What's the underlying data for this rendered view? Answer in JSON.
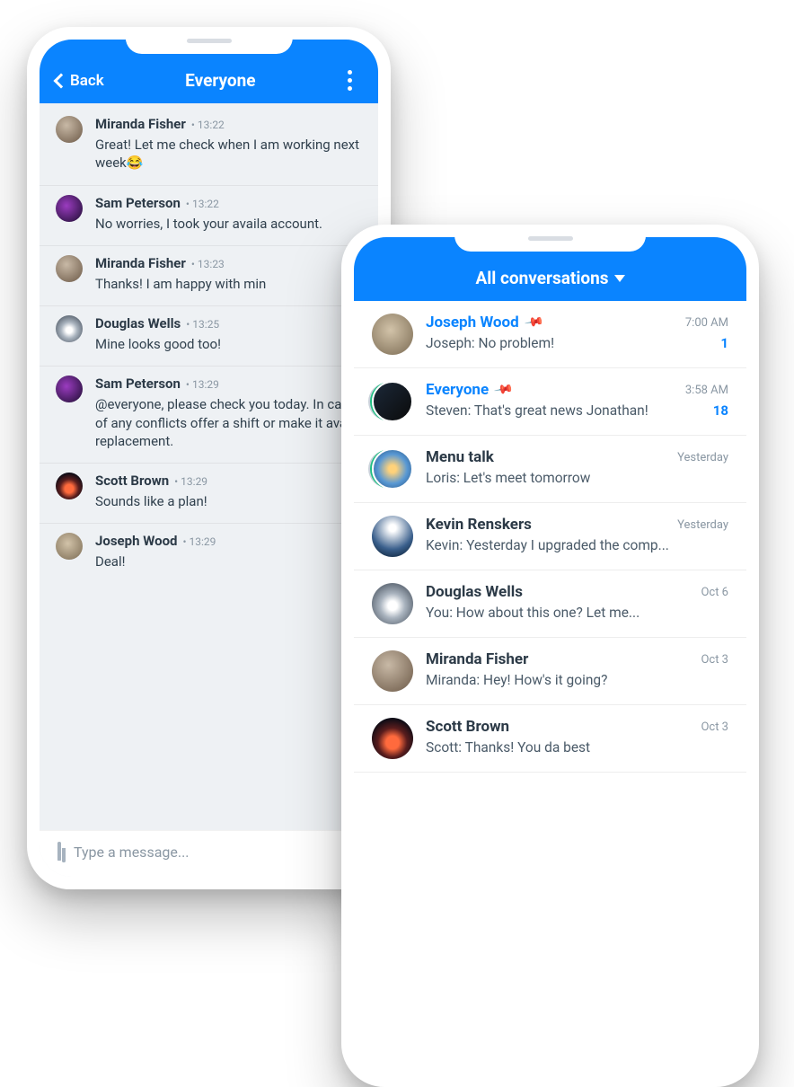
{
  "chat": {
    "back_label": "Back",
    "title": "Everyone",
    "composer_placeholder": "Type a message...",
    "messages": [
      {
        "author": "Miranda Fisher",
        "time": "13:22",
        "text": "Great! Let me check when I am working next week😂"
      },
      {
        "author": "Sam Peterson",
        "time": "13:22",
        "text": "No worries, I took your availa account."
      },
      {
        "author": "Miranda Fisher",
        "time": "13:23",
        "text": "Thanks! I am happy with min"
      },
      {
        "author": "Douglas Wells",
        "time": "13:25",
        "text": "Mine looks good too!"
      },
      {
        "author": "Sam Peterson",
        "time": "13:29",
        "text": "@everyone, please check you today. In case of any conflicts offer a shift or make it availa replacement."
      },
      {
        "author": "Scott Brown",
        "time": "13:29",
        "text": "Sounds like a plan!"
      },
      {
        "author": "Joseph Wood",
        "time": "13:29",
        "text": "Deal!"
      }
    ]
  },
  "inbox": {
    "title": "All conversations",
    "items": [
      {
        "name": "Joseph Wood",
        "pinned": true,
        "time": "7:00 AM",
        "preview": "Joseph: No problem!",
        "badge": "1"
      },
      {
        "name": "Everyone",
        "pinned": true,
        "time": "3:58 AM",
        "preview": "Steven: That's great news Jonathan!",
        "badge": "18"
      },
      {
        "name": "Menu talk",
        "pinned": false,
        "time": "Yesterday",
        "preview": "Loris: Let's meet tomorrow",
        "badge": ""
      },
      {
        "name": "Kevin Renskers",
        "pinned": false,
        "time": "Yesterday",
        "preview": "Kevin: Yesterday I upgraded the comp...",
        "badge": ""
      },
      {
        "name": "Douglas Wells",
        "pinned": false,
        "time": "Oct 6",
        "preview": "You: How about this one? Let me...",
        "badge": ""
      },
      {
        "name": "Miranda Fisher",
        "pinned": false,
        "time": "Oct 3",
        "preview": "Miranda: Hey! How's it going?",
        "badge": ""
      },
      {
        "name": "Scott Brown",
        "pinned": false,
        "time": "Oct 3",
        "preview": "Scott: Thanks! You da best",
        "badge": ""
      }
    ]
  }
}
